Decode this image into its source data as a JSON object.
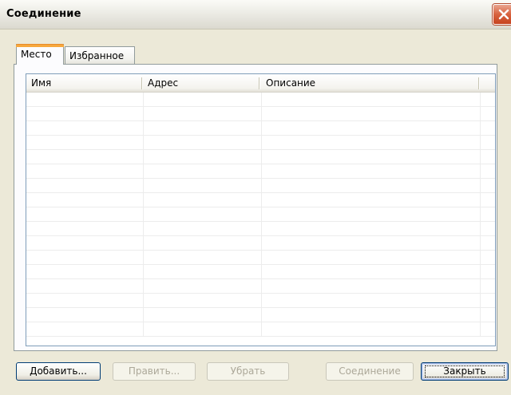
{
  "window": {
    "title": "Соединение",
    "close_icon": "close-icon"
  },
  "tabs": [
    {
      "label": "Место",
      "active": true
    },
    {
      "label": "Избранное",
      "active": false
    }
  ],
  "table": {
    "columns": [
      "Имя",
      "Адрес",
      "Описание"
    ],
    "rows": []
  },
  "buttons": {
    "add": "Добавить...",
    "edit": "Править...",
    "remove": "Убрать",
    "connect": "Соединение",
    "close": "Закрыть"
  },
  "colors": {
    "accent_tab": "#f7a83c",
    "close_button": "#d8623f",
    "dialog_bg": "#ece9d8"
  }
}
